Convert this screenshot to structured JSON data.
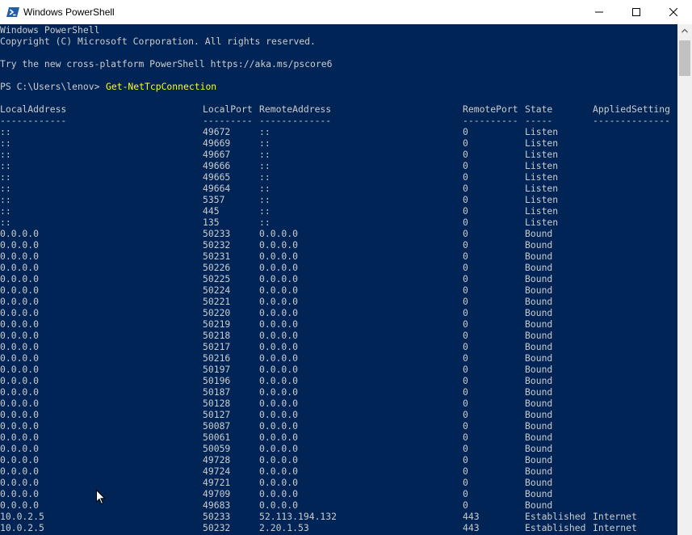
{
  "window": {
    "title": "Windows PowerShell"
  },
  "icons": {
    "app": "powershell-icon",
    "minimize": "minimize-icon",
    "maximize": "maximize-icon",
    "close": "close-icon",
    "scroll_up": "chevron-up-icon",
    "cursor": "mouse-pointer-icon"
  },
  "colors": {
    "background": "#012456",
    "text": "#cccccc",
    "command": "#ffff00"
  },
  "banner": {
    "line1": "Windows PowerShell",
    "line2": "Copyright (C) Microsoft Corporation. All rights reserved.",
    "line3": "Try the new cross-platform PowerShell https://aka.ms/pscore6"
  },
  "prompt": {
    "text": "PS C:\\Users\\lenov> ",
    "command": "Get-NetTcpConnection"
  },
  "table": {
    "headers": [
      "LocalAddress",
      "LocalPort",
      "RemoteAddress",
      "RemotePort",
      "State",
      "AppliedSetting"
    ],
    "underlines": [
      "------------",
      "---------",
      "-------------",
      "----------",
      "-----",
      "--------------"
    ],
    "rows": [
      [
        "::",
        "49672",
        "::",
        "0",
        "Listen",
        ""
      ],
      [
        "::",
        "49669",
        "::",
        "0",
        "Listen",
        ""
      ],
      [
        "::",
        "49667",
        "::",
        "0",
        "Listen",
        ""
      ],
      [
        "::",
        "49666",
        "::",
        "0",
        "Listen",
        ""
      ],
      [
        "::",
        "49665",
        "::",
        "0",
        "Listen",
        ""
      ],
      [
        "::",
        "49664",
        "::",
        "0",
        "Listen",
        ""
      ],
      [
        "::",
        "5357",
        "::",
        "0",
        "Listen",
        ""
      ],
      [
        "::",
        "445",
        "::",
        "0",
        "Listen",
        ""
      ],
      [
        "::",
        "135",
        "::",
        "0",
        "Listen",
        ""
      ],
      [
        "0.0.0.0",
        "50233",
        "0.0.0.0",
        "0",
        "Bound",
        ""
      ],
      [
        "0.0.0.0",
        "50232",
        "0.0.0.0",
        "0",
        "Bound",
        ""
      ],
      [
        "0.0.0.0",
        "50231",
        "0.0.0.0",
        "0",
        "Bound",
        ""
      ],
      [
        "0.0.0.0",
        "50226",
        "0.0.0.0",
        "0",
        "Bound",
        ""
      ],
      [
        "0.0.0.0",
        "50225",
        "0.0.0.0",
        "0",
        "Bound",
        ""
      ],
      [
        "0.0.0.0",
        "50224",
        "0.0.0.0",
        "0",
        "Bound",
        ""
      ],
      [
        "0.0.0.0",
        "50221",
        "0.0.0.0",
        "0",
        "Bound",
        ""
      ],
      [
        "0.0.0.0",
        "50220",
        "0.0.0.0",
        "0",
        "Bound",
        ""
      ],
      [
        "0.0.0.0",
        "50219",
        "0.0.0.0",
        "0",
        "Bound",
        ""
      ],
      [
        "0.0.0.0",
        "50218",
        "0.0.0.0",
        "0",
        "Bound",
        ""
      ],
      [
        "0.0.0.0",
        "50217",
        "0.0.0.0",
        "0",
        "Bound",
        ""
      ],
      [
        "0.0.0.0",
        "50216",
        "0.0.0.0",
        "0",
        "Bound",
        ""
      ],
      [
        "0.0.0.0",
        "50197",
        "0.0.0.0",
        "0",
        "Bound",
        ""
      ],
      [
        "0.0.0.0",
        "50196",
        "0.0.0.0",
        "0",
        "Bound",
        ""
      ],
      [
        "0.0.0.0",
        "50187",
        "0.0.0.0",
        "0",
        "Bound",
        ""
      ],
      [
        "0.0.0.0",
        "50128",
        "0.0.0.0",
        "0",
        "Bound",
        ""
      ],
      [
        "0.0.0.0",
        "50127",
        "0.0.0.0",
        "0",
        "Bound",
        ""
      ],
      [
        "0.0.0.0",
        "50087",
        "0.0.0.0",
        "0",
        "Bound",
        ""
      ],
      [
        "0.0.0.0",
        "50061",
        "0.0.0.0",
        "0",
        "Bound",
        ""
      ],
      [
        "0.0.0.0",
        "50059",
        "0.0.0.0",
        "0",
        "Bound",
        ""
      ],
      [
        "0.0.0.0",
        "49728",
        "0.0.0.0",
        "0",
        "Bound",
        ""
      ],
      [
        "0.0.0.0",
        "49724",
        "0.0.0.0",
        "0",
        "Bound",
        ""
      ],
      [
        "0.0.0.0",
        "49721",
        "0.0.0.0",
        "0",
        "Bound",
        ""
      ],
      [
        "0.0.0.0",
        "49709",
        "0.0.0.0",
        "0",
        "Bound",
        ""
      ],
      [
        "0.0.0.0",
        "49683",
        "0.0.0.0",
        "0",
        "Bound",
        ""
      ],
      [
        "10.0.2.5",
        "50233",
        "52.113.194.132",
        "443",
        "Established",
        "Internet"
      ],
      [
        "10.0.2.5",
        "50232",
        "2.20.1.53",
        "443",
        "Established",
        "Internet"
      ]
    ]
  }
}
